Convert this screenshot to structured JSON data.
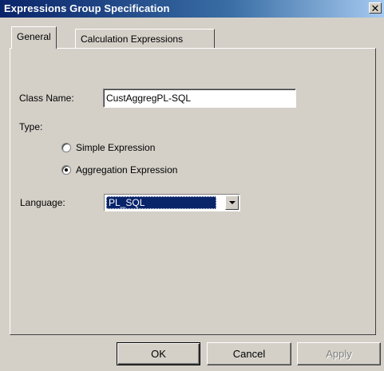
{
  "window": {
    "title": "Expressions Group Specification",
    "close_glyph": "✕"
  },
  "tabs": [
    {
      "label": "General",
      "active": true
    },
    {
      "label": "Calculation Expressions",
      "active": false
    }
  ],
  "general": {
    "class_name_label": "Class Name:",
    "class_name_value": "CustAggregPL-SQL",
    "type_label": "Type:",
    "type_options": [
      {
        "label": "Simple Expression",
        "selected": false
      },
      {
        "label": "Aggregation Expression",
        "selected": true
      }
    ],
    "language_label": "Language:",
    "language_value": "PL_SQL"
  },
  "buttons": {
    "ok": "OK",
    "cancel": "Cancel",
    "apply": "Apply",
    "apply_enabled": false
  },
  "colors": {
    "titlebar": "#0a246a",
    "face": "#d4d0c8",
    "selection": "#0a246a"
  }
}
